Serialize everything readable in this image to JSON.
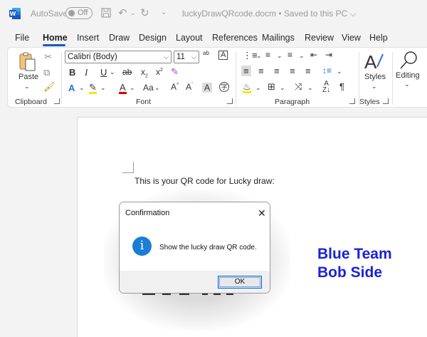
{
  "titlebar": {
    "autosave_label": "AutoSave",
    "autosave_state": "Off",
    "document_title": "luckyDrawQRcode.docm  •  Saved to this PC ⌵"
  },
  "menu": {
    "tabs": [
      "File",
      "Home",
      "Insert",
      "Draw",
      "Design",
      "Layout",
      "References",
      "Mailings",
      "Review",
      "View",
      "Help"
    ],
    "active": "Home"
  },
  "ribbon": {
    "clipboard": {
      "label": "Clipboard",
      "paste": "Paste"
    },
    "font": {
      "label": "Font",
      "font_name": "Calibri (Body)",
      "font_size": "11"
    },
    "paragraph": {
      "label": "Paragraph"
    },
    "styles": {
      "label": "Styles",
      "button": "Styles"
    },
    "editing": {
      "button": "Editing"
    }
  },
  "document": {
    "body_text": "This is your QR code for Lucky draw:",
    "watermark_line1": "Blue Team",
    "watermark_line2": "Bob Side"
  },
  "dialog": {
    "title": "Confirmation",
    "message": "Show the lucky draw QR code.",
    "ok_label": "OK",
    "close_glyph": "✕",
    "info_glyph": "i"
  },
  "colors": {
    "accent": "#185abd",
    "watermark": "#1a22d6",
    "info": "#1b7ed6"
  }
}
